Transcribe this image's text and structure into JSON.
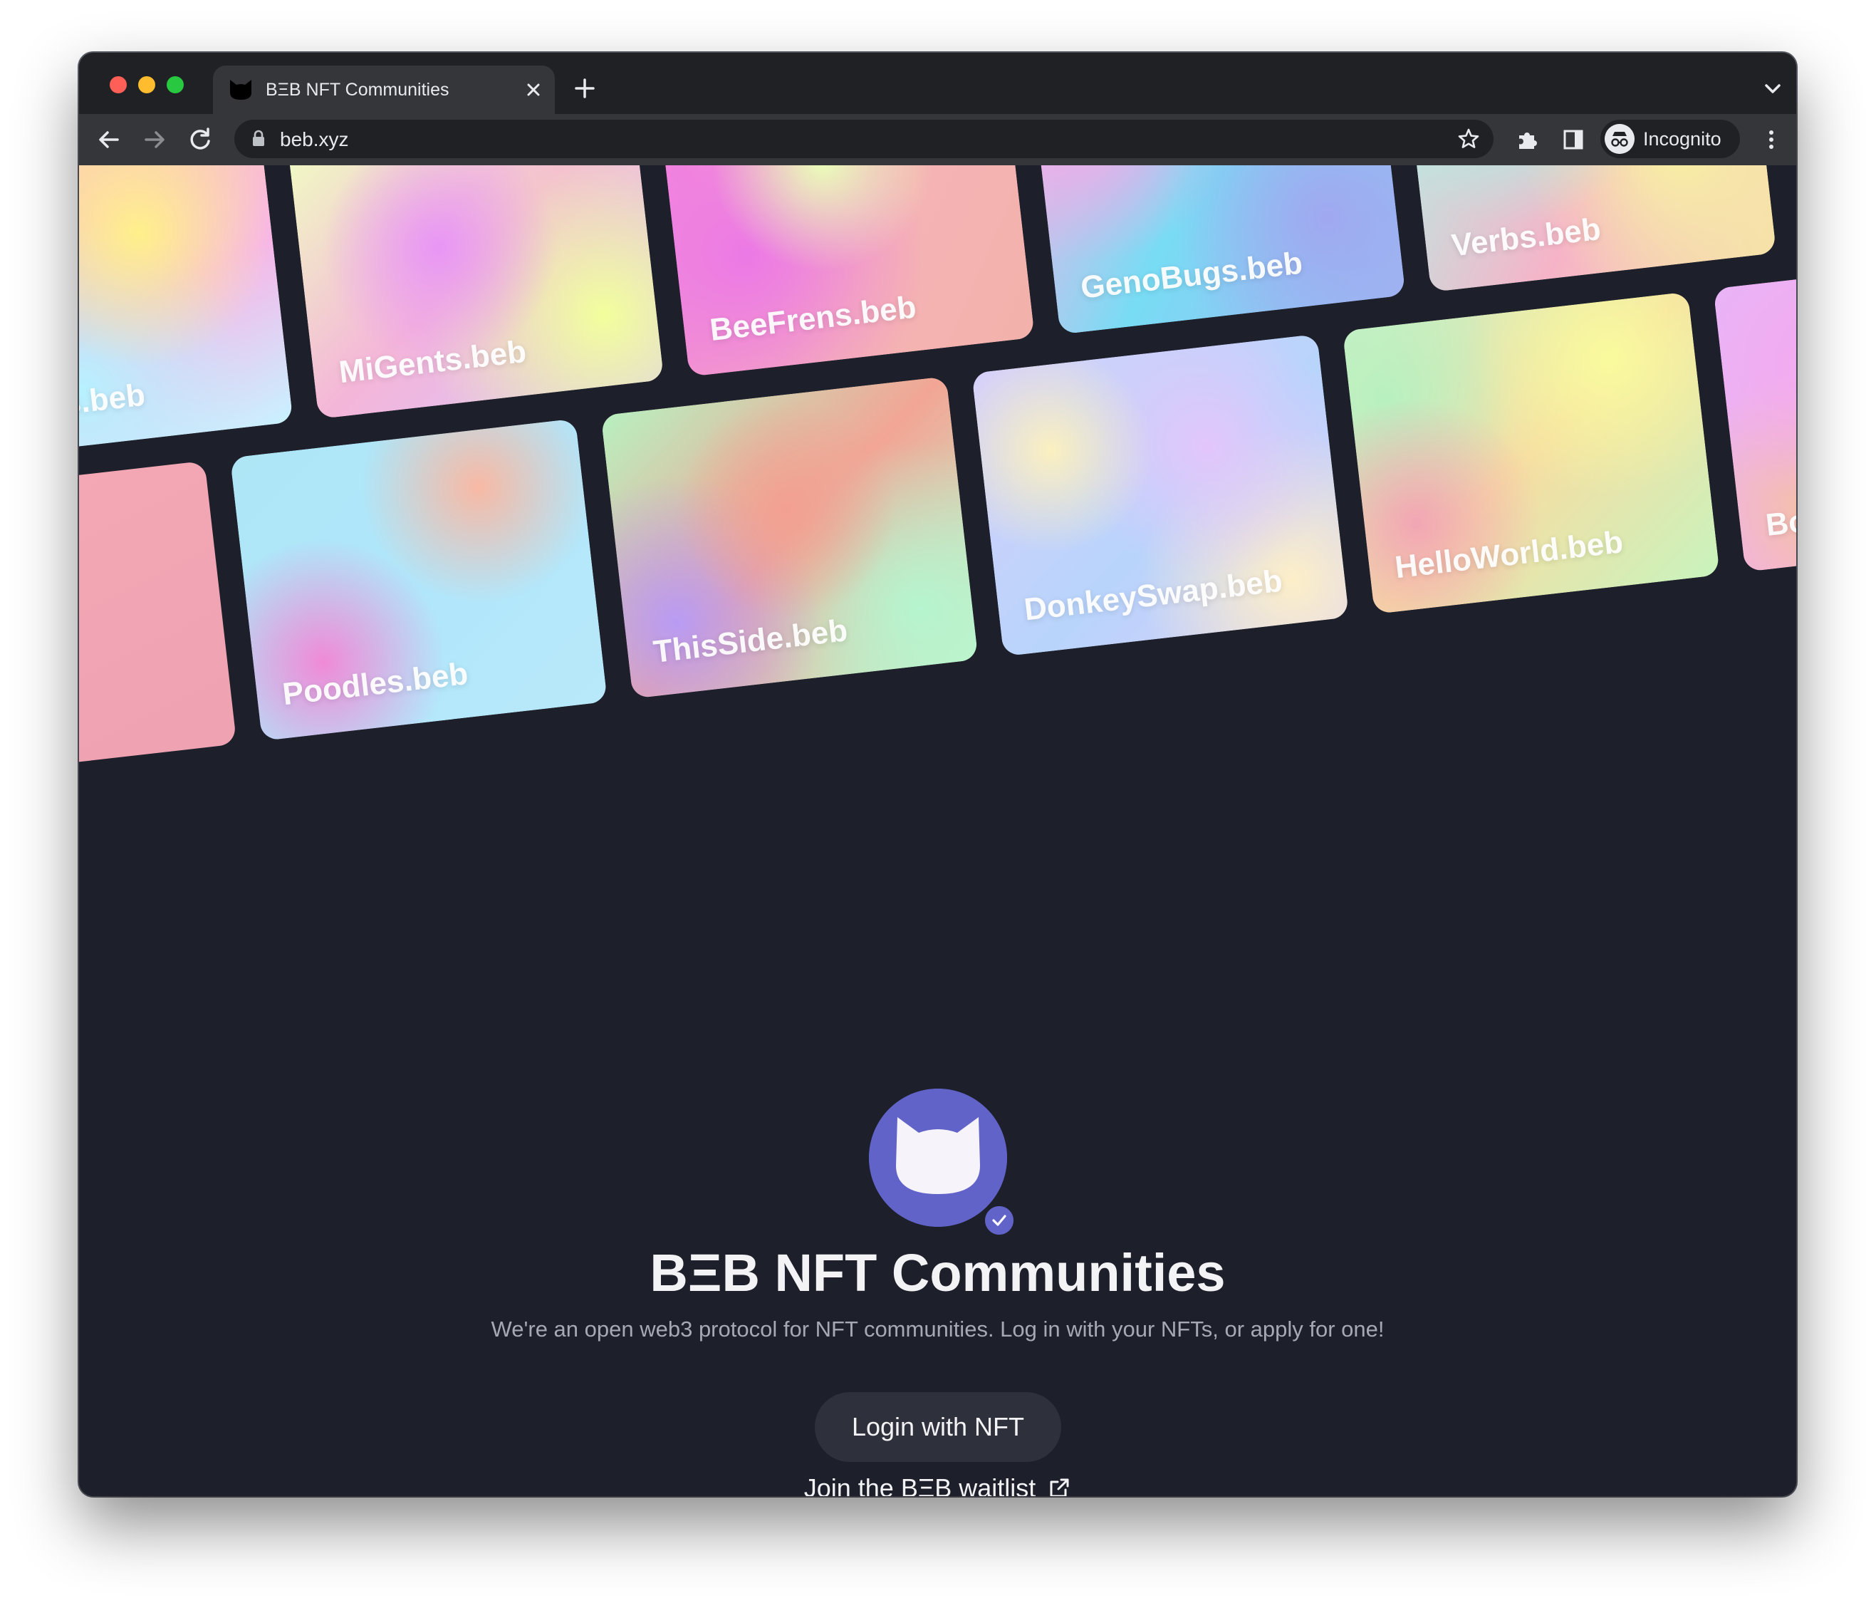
{
  "browser": {
    "tab_title": "BΞB NFT Communities",
    "url": "beb.xyz",
    "profile_label": "Incognito",
    "icons": [
      "cat-favicon-icon",
      "close-icon",
      "plus-icon",
      "chevron-down-icon",
      "back-arrow-icon",
      "forward-arrow-icon",
      "reload-icon",
      "lock-icon",
      "star-icon",
      "puzzle-icon",
      "side-panel-icon",
      "incognito-icon",
      "kebab-menu-icon"
    ]
  },
  "cards": [
    {
      "label": "nDucks.beb"
    },
    {
      "label": "MiGents.beb"
    },
    {
      "label": "BeeFrens.beb"
    },
    {
      "label": "GenoBugs.beb"
    },
    {
      "label": "Verbs.beb"
    },
    {
      "label": ""
    },
    {
      "label": "Poodles.beb"
    },
    {
      "label": "ThisSide.beb"
    },
    {
      "label": "DonkeySwap.beb"
    },
    {
      "label": "HelloWorld.beb"
    },
    {
      "label": "Bored"
    }
  ],
  "hero": {
    "title": "BΞB NFT Communities",
    "subtitle": "We're an open web3 protocol for NFT communities. Log in with your NFTs, or apply for one!",
    "login_label": "Login with NFT",
    "waitlist_label": "Join the BΞB waitlist"
  },
  "colors": {
    "page_background": "#1d202a",
    "brand_purple": "#6263c9",
    "button_background": "#2e313b"
  }
}
